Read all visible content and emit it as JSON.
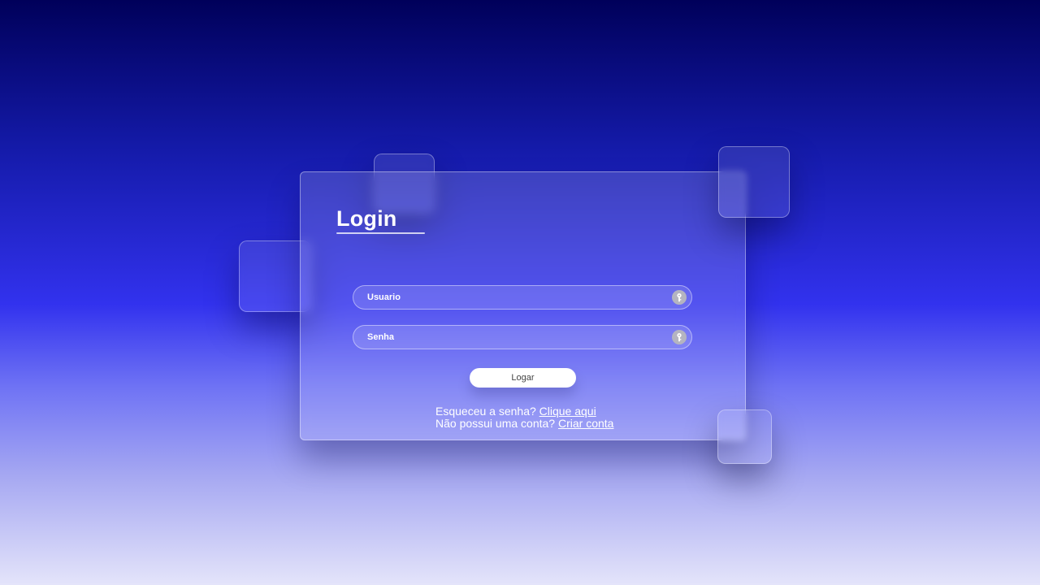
{
  "login_card": {
    "title": "Login",
    "username": {
      "placeholder": "Usuario",
      "value": "",
      "icon": "key-icon"
    },
    "password": {
      "placeholder": "Senha",
      "value": "",
      "icon": "key-icon"
    },
    "submit_label": "Logar",
    "forgot": {
      "text": "Esqueceu a senha?",
      "link": "Clique aqui"
    },
    "signup": {
      "text": "Não possui uma conta?",
      "link": "Criar conta"
    }
  },
  "colors": {
    "background_top": "#00005a",
    "background_middle": "#3232ee",
    "background_bottom": "#e4e4fa",
    "text": "#ffffff",
    "button_background": "#ffffff",
    "button_text": "#444444"
  }
}
